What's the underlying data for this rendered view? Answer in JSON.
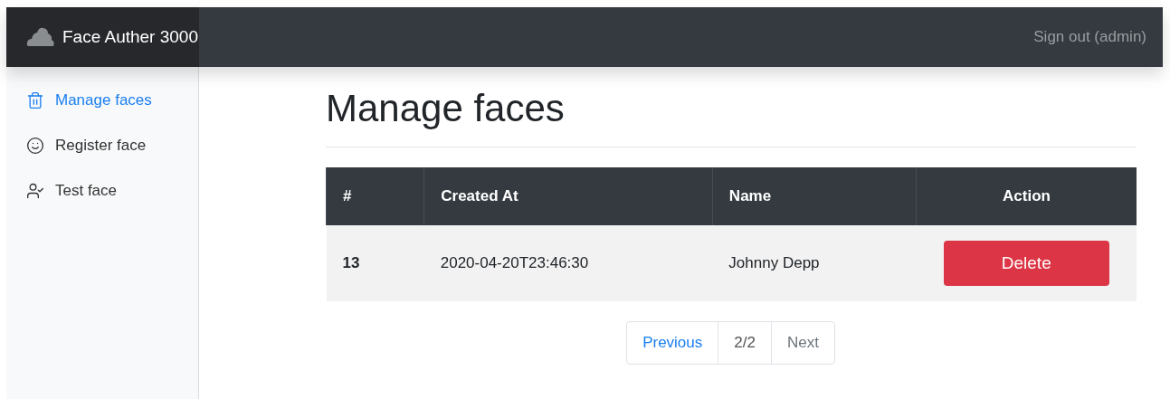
{
  "navbar": {
    "brand": "Face Auther 3000",
    "signout": "Sign out (admin)"
  },
  "sidebar": {
    "items": [
      {
        "kind": "trash",
        "label": "Manage faces",
        "selected": true
      },
      {
        "kind": "smile",
        "label": "Register face",
        "selected": false
      },
      {
        "kind": "user-check",
        "label": "Test face",
        "selected": false
      }
    ]
  },
  "page": {
    "title": "Manage faces"
  },
  "table": {
    "columns": [
      "#",
      "Created At",
      "Name",
      "Action"
    ],
    "rows": [
      {
        "id": "13",
        "created_at": "2020-04-20T23:46:30",
        "name": "Johnny Depp",
        "action": "Delete"
      }
    ]
  },
  "pagination": [
    {
      "kind": "link",
      "label": "Previous",
      "disabled": false
    },
    {
      "kind": "current",
      "label": "2/2"
    },
    {
      "kind": "link",
      "label": "Next",
      "disabled": true
    }
  ]
}
